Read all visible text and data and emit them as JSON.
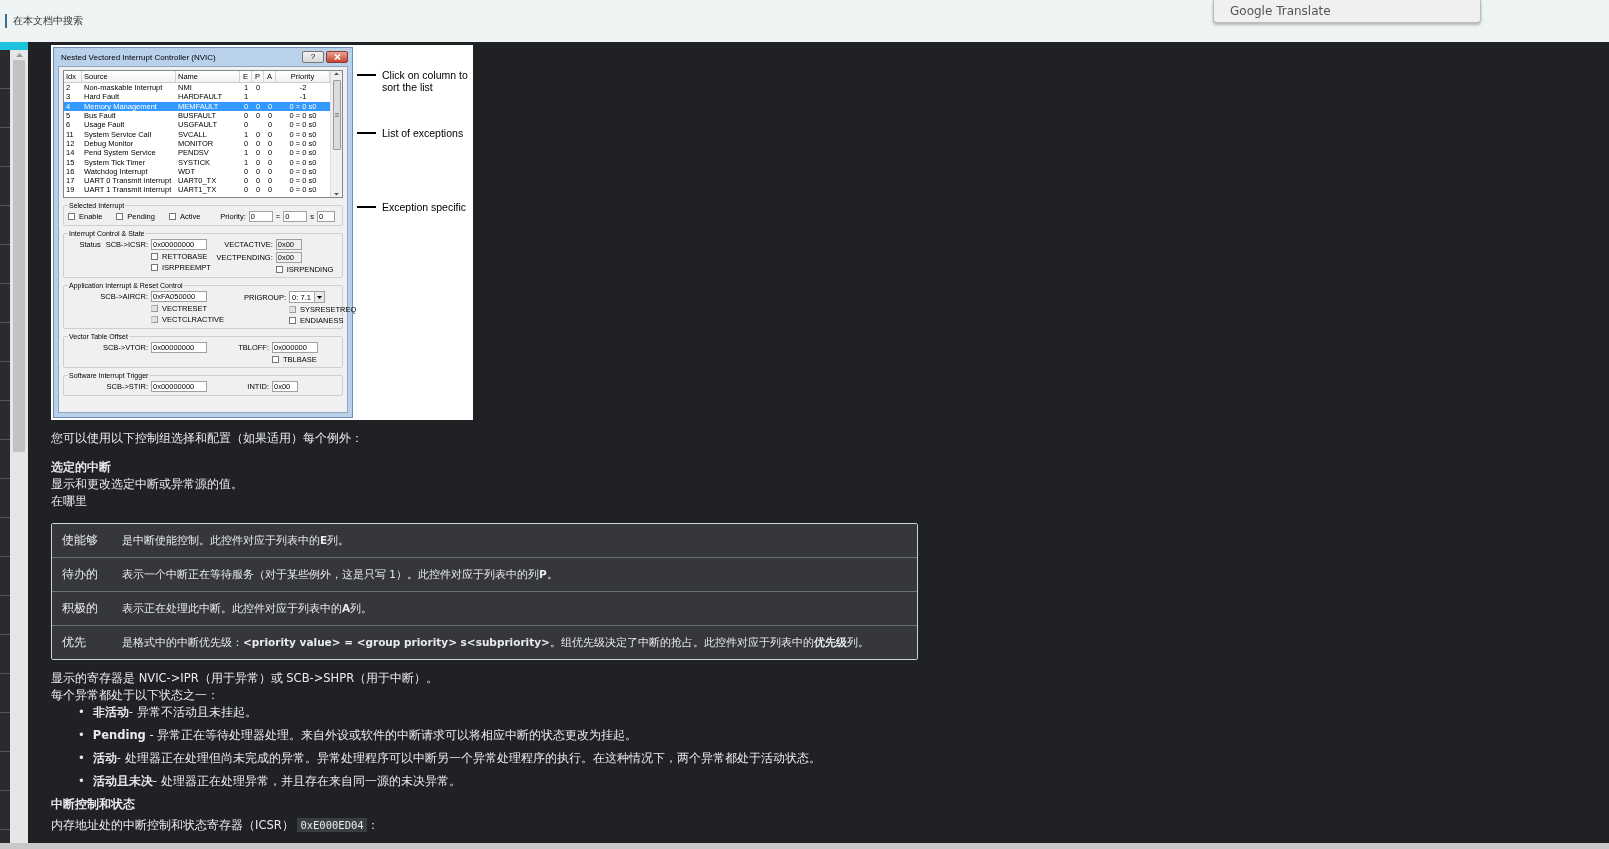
{
  "top_bar": {
    "search_label": "在本文档中搜索",
    "popup": {
      "text": "Google Translate"
    }
  },
  "figure": {
    "dialog": {
      "title": "Nested Vectored Interrupt Controller (NVIC)",
      "help_button": "?",
      "columns": [
        "Idx",
        "Source",
        "Name",
        "E",
        "P",
        "A",
        "Priority"
      ],
      "rows": [
        {
          "idx": "2",
          "source": "Non-maskable Interrupt",
          "name": "NMI",
          "e": "1",
          "p": "0",
          "priority": "-2",
          "selected": false
        },
        {
          "idx": "3",
          "source": "Hard Fault",
          "name": "HARDFAULT",
          "e": "1",
          "priority": "-1",
          "selected": false
        },
        {
          "idx": "4",
          "source": "Memory Management",
          "name": "MEMFAULT",
          "e": "0",
          "p": "0",
          "a": "0",
          "priority": "0 = 0 s0",
          "selected": true
        },
        {
          "idx": "5",
          "source": "Bus Fault",
          "name": "BUSFAULT",
          "e": "0",
          "p": "0",
          "a": "0",
          "priority": "0 = 0 s0",
          "selected": false
        },
        {
          "idx": "6",
          "source": "Usage Fault",
          "name": "USGFAULT",
          "e": "0",
          "a": "0",
          "priority": "0 = 0 s0",
          "selected": false
        },
        {
          "idx": "11",
          "source": "System Service Call",
          "name": "SVCALL",
          "e": "1",
          "p": "0",
          "a": "0",
          "priority": "0 = 0 s0",
          "selected": false
        },
        {
          "idx": "12",
          "source": "Debug Monitor",
          "name": "MONITOR",
          "e": "0",
          "p": "0",
          "a": "0",
          "priority": "0 = 0 s0",
          "selected": false
        },
        {
          "idx": "14",
          "source": "Pend System Service",
          "name": "PENDSV",
          "e": "1",
          "p": "0",
          "a": "0",
          "priority": "0 = 0 s0",
          "selected": false
        },
        {
          "idx": "15",
          "source": "System Tick Timer",
          "name": "SYSTICK",
          "e": "1",
          "p": "0",
          "a": "0",
          "priority": "0 = 0 s0",
          "selected": false
        },
        {
          "idx": "16",
          "source": "Watchdog Interrupt",
          "name": "WDT",
          "e": "0",
          "p": "0",
          "a": "0",
          "priority": "0 = 0 s0",
          "selected": false
        },
        {
          "idx": "17",
          "source": "UART 0 Transmit Interrupt",
          "name": "UART0_TX",
          "e": "0",
          "p": "0",
          "a": "0",
          "priority": "0 = 0 s0",
          "selected": false
        },
        {
          "idx": "19",
          "source": "UART 1 Transmit Interrupt",
          "name": "UART1_TX",
          "e": "0",
          "p": "0",
          "a": "0",
          "priority": "0 = 0 s0",
          "selected": false
        }
      ],
      "selected_interrupt": {
        "title": "Selected Interrupt",
        "checkboxes": [
          {
            "label": "Enable",
            "checked": false
          },
          {
            "label": "Pending",
            "checked": false
          },
          {
            "label": "Active",
            "checked": false
          }
        ],
        "priority_label": "Priority:",
        "priority_fields": [
          {
            "value": "0"
          },
          {
            "sep": "=",
            "value": "0"
          },
          {
            "sep": "s",
            "value": "0"
          }
        ]
      },
      "groups": [
        {
          "title": "Interrupt Control & State",
          "columns": [
            [
              {
                "kind": "field",
                "prefix": "Status",
                "label": "SCB->ICSR:",
                "value": "0x00000000",
                "disabled": false
              },
              {
                "kind": "checkbox",
                "label": "RETTOBASE",
                "checked": false,
                "disabled": false
              },
              {
                "kind": "checkbox",
                "label": "ISRPREEMPT",
                "checked": false,
                "disabled": false
              }
            ],
            [
              {
                "kind": "field",
                "label": "VECTACTIVE:",
                "value": "0x00",
                "disabled": true
              },
              {
                "kind": "field",
                "label": "VECTPENDING:",
                "value": "0x00",
                "disabled": true
              },
              {
                "kind": "checkbox",
                "label": "ISRPENDING",
                "checked": false,
                "disabled": false
              }
            ]
          ]
        },
        {
          "title": "Application Interrupt & Reset Control",
          "columns": [
            [
              {
                "kind": "field",
                "label": "SCB->AIRCR:",
                "value": "0xFA050000",
                "disabled": false
              },
              {
                "kind": "checkbox",
                "label": "VECTRESET",
                "checked": false,
                "disabled": true
              },
              {
                "kind": "checkbox",
                "label": "VECTCLRACTIVE",
                "checked": false,
                "disabled": true
              }
            ],
            [
              {
                "kind": "select",
                "label": "PRIGROUP:",
                "value": "0: 7.1"
              },
              {
                "kind": "checkbox",
                "label": "SYSRESETREQ",
                "checked": false,
                "disabled": true
              },
              {
                "kind": "checkbox",
                "label": "ENDIANESS",
                "checked": false,
                "disabled": false
              }
            ]
          ]
        },
        {
          "title": "Vector Table Offset",
          "columns": [
            [
              {
                "kind": "field",
                "label": "SCB->VTOR:",
                "value": "0x00000000",
                "disabled": false
              }
            ],
            [
              {
                "kind": "field",
                "label": "TBLOFF:",
                "value": "0x000000",
                "disabled": false
              },
              {
                "kind": "checkbox",
                "label": "TBLBASE",
                "checked": false,
                "disabled": false
              }
            ]
          ]
        },
        {
          "title": "Software Interrupt Trigger",
          "columns": [
            [
              {
                "kind": "field",
                "label": "SCB->STIR:",
                "value": "0x00000000",
                "disabled": false
              }
            ],
            [
              {
                "kind": "field",
                "label": "INTID:",
                "value": "0x00",
                "disabled": false
              }
            ]
          ]
        }
      ]
    },
    "annotations": [
      {
        "text": "Click on column to sort the list"
      },
      {
        "text": "List of exceptions"
      },
      {
        "text": "Exception specific"
      }
    ]
  },
  "intro": "您可以使用以下控制组选择和配置（如果适用）每个例外：",
  "section_heading": "选定的中断",
  "section_lines": [
    "显示和更改选定中断或异常源的值。",
    "在哪里"
  ],
  "definitions": [
    {
      "term": "使能够",
      "text": "是中断使能控制。此控件对应于列表中的**E**列。"
    },
    {
      "term": "待办的",
      "text": "表示一个中断正在等待服务（对于某些例外，这是只写 1）。此控件对应于列表中的列**P**。"
    },
    {
      "term": "积极的",
      "text": "表示正在处理此中断。此控件对应于列表中的**A**列。"
    },
    {
      "term": "优先",
      "text": "是格式中的中断优先级：**<priority value> = <group priority> s<subpriority>**。组优先级决定了中断的抢占。此控件对应于列表中的**优先级**列。"
    }
  ],
  "after_lines": [
    "显示的寄存器是 NVIC->IPR（用于异常）或 SCB->SHPR（用于中断）。",
    "每个异常都处于以下状态之一："
  ],
  "states": [
    {
      "bullet": "•",
      "text": "**非活动**- 异常不活动且未挂起。"
    },
    {
      "bullet": "•",
      "text": "**Pending** - 异常正在等待处理器处理。来自外设或软件的中断请求可以将相应中断的状态更改为挂起。"
    },
    {
      "bullet": "•",
      "text": "**活动**- 处理器正在处理但尚未完成的异常。异常处理程序可以中断另一个异常处理程序的执行。在这种情况下，两个异常都处于活动状态。"
    },
    {
      "bullet": "•",
      "text": "**活动且未决**- 处理器正在处理异常，并且存在来自同一源的未决异常。"
    }
  ],
  "heading2": "中断控制和状态",
  "icsr_line": {
    "before": "内存地址处的中断控制和状态寄存器（ICSR）",
    "code": "0xE000ED04",
    "after": "："
  }
}
